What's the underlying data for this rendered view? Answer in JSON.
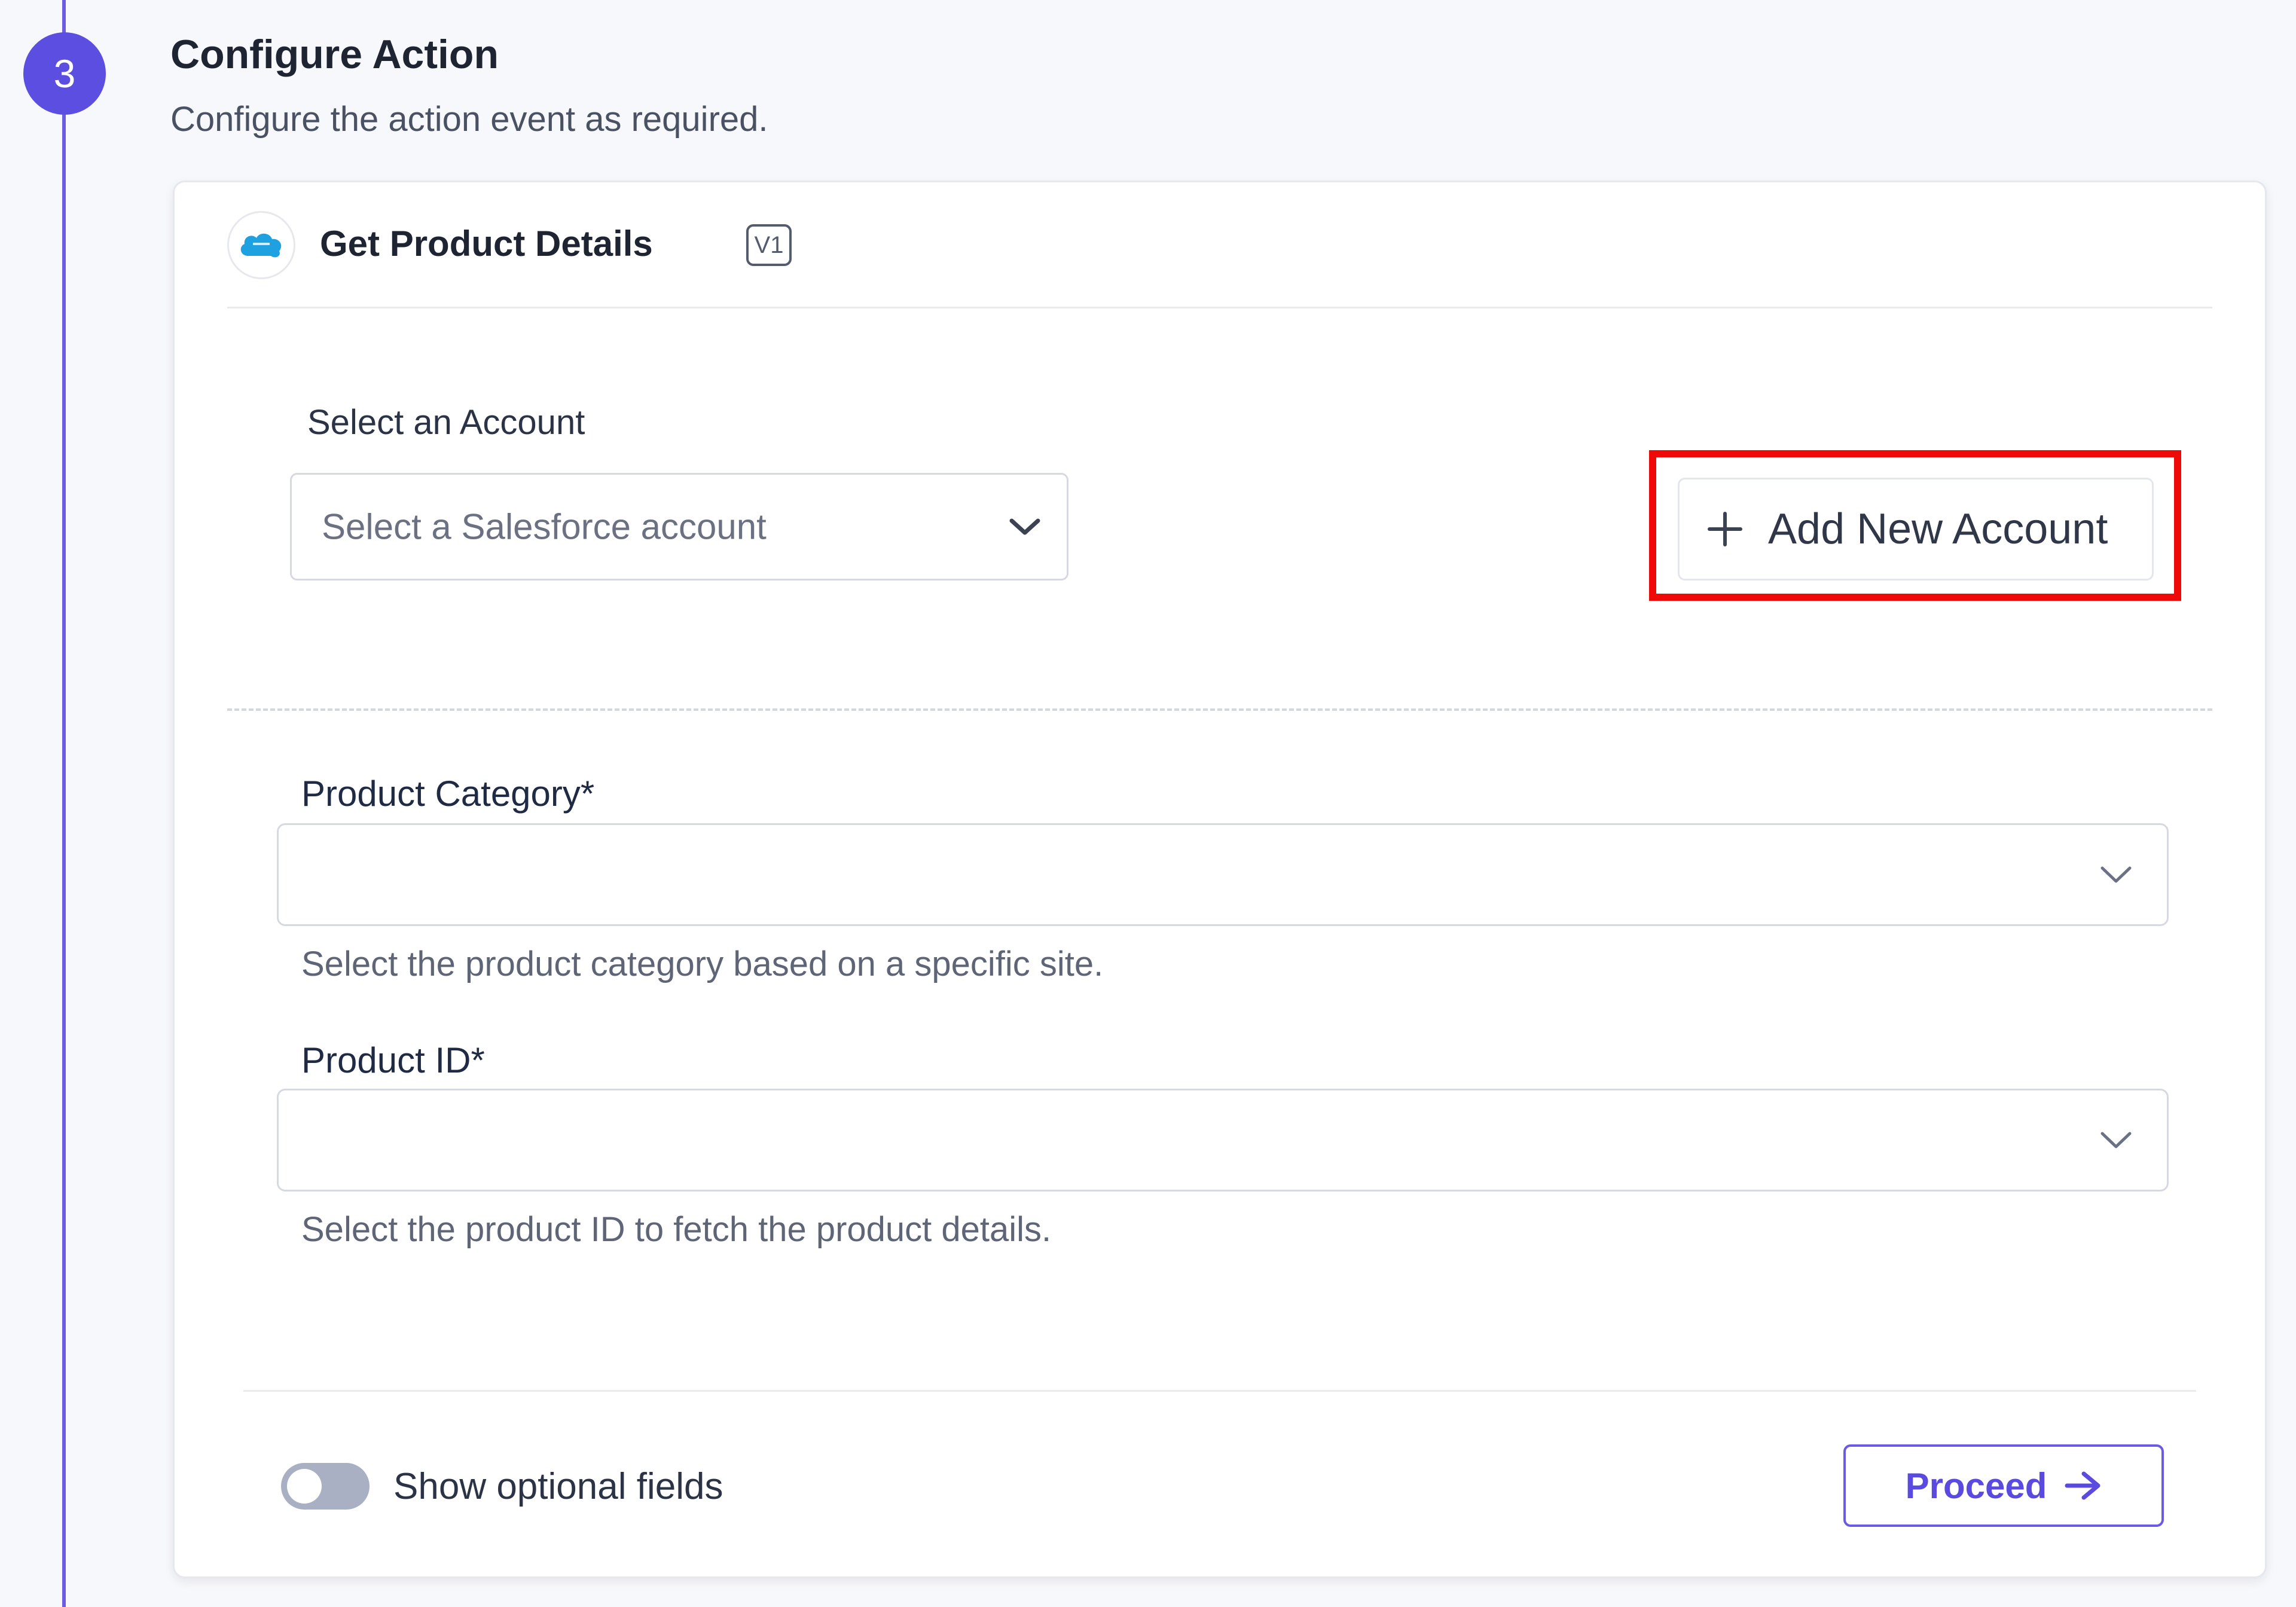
{
  "step": {
    "number": "3",
    "title": "Configure Action",
    "subtitle": "Configure the action event as required."
  },
  "card": {
    "app_icon": "salesforce-cloud-icon",
    "action_name": "Get Product Details",
    "version": "V1",
    "account": {
      "label": "Select an Account",
      "placeholder": "Select a Salesforce account",
      "add_button_label": "Add New Account"
    },
    "fields": [
      {
        "label": "Product Category*",
        "value": "",
        "help": "Select the product category based on a specific site."
      },
      {
        "label": "Product ID*",
        "value": "",
        "help": "Select the product ID to fetch the product details."
      }
    ],
    "footer": {
      "toggle_label": "Show optional fields",
      "toggle_on": false,
      "proceed_label": "Proceed"
    }
  },
  "colors": {
    "accent": "#5b4ee0",
    "highlight": "#ef0a0a",
    "salesforce": "#1ea1e0"
  }
}
